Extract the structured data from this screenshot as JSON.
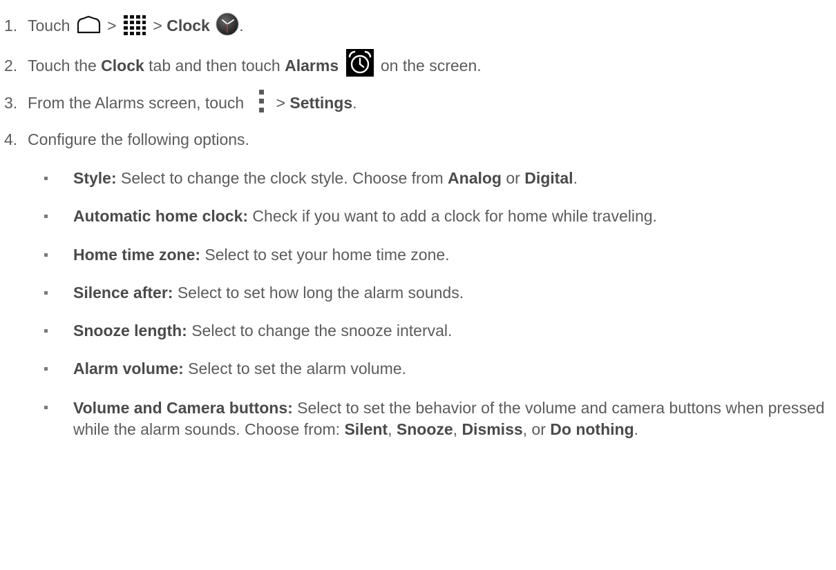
{
  "steps": [
    {
      "num": "1.",
      "parts": [
        "Touch",
        ">",
        ">",
        "Clock",
        "."
      ],
      "icons": [
        "home-icon",
        "apps-grid-icon",
        "clock-app-icon"
      ]
    },
    {
      "num": "2.",
      "parts": [
        "Touch the",
        "Clock",
        "tab and then touch",
        "Alarms",
        "on the screen."
      ],
      "icons": [
        "alarm-icon"
      ]
    },
    {
      "num": "3.",
      "parts": [
        "From the Alarms screen, touch",
        "> ",
        "Settings",
        "."
      ],
      "icons": [
        "menu-dots-icon"
      ]
    },
    {
      "num": "4.",
      "parts": [
        "Configure the following options."
      ]
    }
  ],
  "options": [
    {
      "label": "Style:",
      "text": " Select to change the clock style. Choose from ",
      "b1": "Analog",
      "mid": " or ",
      "b2": "Digital",
      "end": "."
    },
    {
      "label": "Automatic home clock:",
      "text": " Check if you want to add a clock for home while traveling."
    },
    {
      "label": "Home time zone:",
      "text": " Select to set your home time zone."
    },
    {
      "label": "Silence after:",
      "text": " Select to set how long the alarm sounds."
    },
    {
      "label": "Snooze length:",
      "text": " Select to change the snooze interval."
    },
    {
      "label": "Alarm volume:",
      "text": " Select to set the alarm volume."
    },
    {
      "label": "Volume and Camera buttons:",
      "text": " Select to set the behavior of the volume and camera buttons when pressed while the alarm sounds. Choose from: ",
      "b1": "Silent",
      "s1": ", ",
      "b2": "Snooze",
      "s2": ", ",
      "b3": "Dismiss",
      "s3": ", or ",
      "b4": "Do nothing",
      "end": "."
    }
  ]
}
